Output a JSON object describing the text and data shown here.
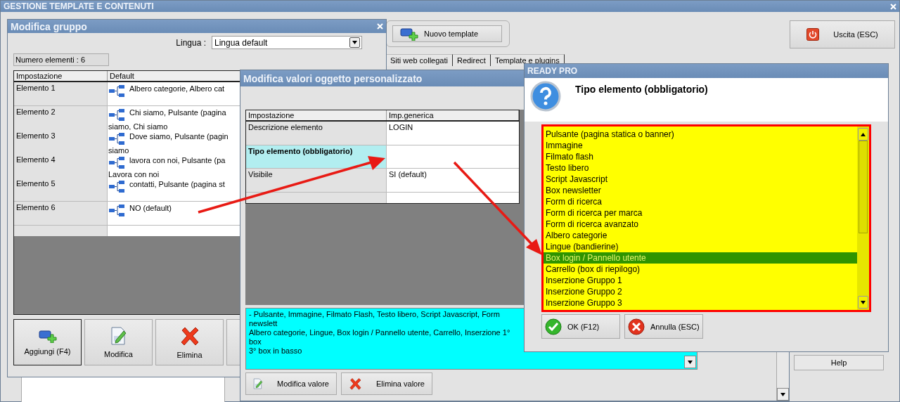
{
  "main_window": {
    "title": "GESTIONE TEMPLATE E CONTENUTI",
    "new_template_button": "Nuovo template",
    "exit_button": "Uscita (ESC)",
    "tabs": [
      "Siti web collegati",
      "Redirect",
      "Template e plugins"
    ],
    "help_button": "Help"
  },
  "group_dialog": {
    "title": "Modifica gruppo",
    "language_label": "Lingua :",
    "language_value": "Lingua default",
    "count": "Numero elementi : 6",
    "columns": [
      "Impostazione",
      "Default"
    ],
    "rows": [
      {
        "name": "Elemento 1",
        "lines": [
          "Albero categorie, Albero cat"
        ]
      },
      {
        "name": "Elemento 2",
        "lines": [
          "Chi siamo, Pulsante (pagina",
          "siamo, Chi siamo"
        ]
      },
      {
        "name": "Elemento 3",
        "lines": [
          "Dove siamo, Pulsante (pagin",
          "siamo"
        ]
      },
      {
        "name": "Elemento 4",
        "lines": [
          "lavora con noi, Pulsante (pa",
          "Lavora con noi"
        ]
      },
      {
        "name": "Elemento 5",
        "lines": [
          "contatti, Pulsante (pagina st"
        ]
      },
      {
        "name": "Elemento 6",
        "lines": [
          "NO (default)"
        ]
      }
    ],
    "buttons": [
      {
        "label": "Aggiungi (F4)",
        "kind": "add"
      },
      {
        "label": "Modifica",
        "kind": "edit"
      },
      {
        "label": "Elimina",
        "kind": "delete"
      }
    ]
  },
  "values_dialog": {
    "title": "Modifica valori oggetto personalizzato",
    "columns": [
      "Impostazione",
      "Imp.generica"
    ],
    "rows": [
      {
        "name": "Descrizione elemento",
        "value": "LOGIN",
        "selected": false
      },
      {
        "name": "Tipo elemento (obbligatorio)",
        "selected": true
      },
      {
        "name": "Visibile",
        "value": "SI (default)",
        "selected": false
      }
    ],
    "description_lines": [
      "- Pulsante, Immagine, Filmato Flash, Testo libero, Script Javascript, Form newslett",
      "Albero categorie, Lingue, Box login / Pannello utente, Carrello, Inserzione 1° box",
      "3° box in basso"
    ],
    "buttons": [
      {
        "label": "Modifica valore",
        "kind": "edit"
      },
      {
        "label": "Elimina valore",
        "kind": "delete"
      }
    ]
  },
  "choice_dialog": {
    "title": "READY PRO",
    "question": "Tipo elemento (obbligatorio)",
    "options": [
      {
        "label": "Pulsante (pagina statica o banner)",
        "selected": false
      },
      {
        "label": "Immagine",
        "selected": false
      },
      {
        "label": "Filmato flash",
        "selected": false
      },
      {
        "label": "Testo libero",
        "selected": false
      },
      {
        "label": "Script Javascript",
        "selected": false
      },
      {
        "label": "Box newsletter",
        "selected": false
      },
      {
        "label": "Form di ricerca",
        "selected": false
      },
      {
        "label": "Form di ricerca per marca",
        "selected": false
      },
      {
        "label": "Form di ricerca avanzato",
        "selected": false
      },
      {
        "label": "Albero categorie",
        "selected": false
      },
      {
        "label": "Lingue (bandierine)",
        "selected": false
      },
      {
        "label": "Box login / Pannello utente",
        "selected": true
      },
      {
        "label": "Carrello (box di riepilogo)",
        "selected": false
      },
      {
        "label": "Inserzione Gruppo 1",
        "selected": false
      },
      {
        "label": "Inserzione Gruppo 2",
        "selected": false
      },
      {
        "label": "Inserzione Gruppo 3",
        "selected": false
      }
    ],
    "buttons": [
      {
        "label": "OK (F12)",
        "kind": "ok"
      },
      {
        "label": "Annulla (ESC)",
        "kind": "cancel"
      }
    ]
  }
}
